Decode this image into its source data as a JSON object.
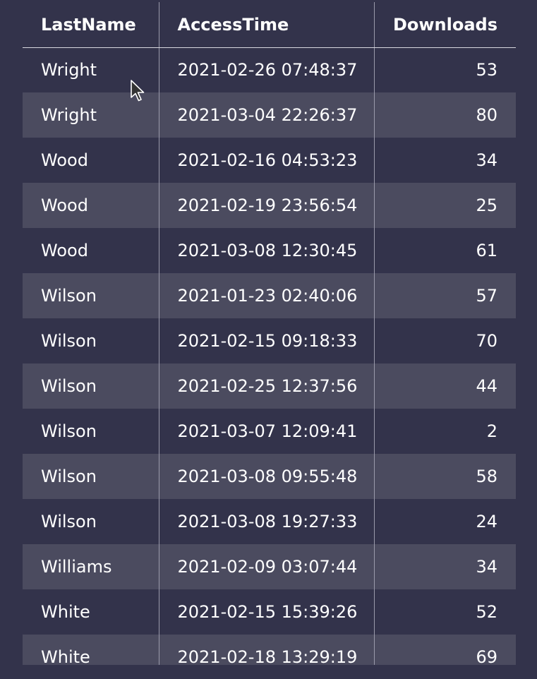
{
  "table": {
    "columns": [
      "LastName",
      "AccessTime",
      "Downloads"
    ],
    "rows": [
      [
        "Wright",
        "2021-02-26 07:48:37",
        "53"
      ],
      [
        "Wright",
        "2021-03-04 22:26:37",
        "80"
      ],
      [
        "Wood",
        "2021-02-16 04:53:23",
        "34"
      ],
      [
        "Wood",
        "2021-02-19 23:56:54",
        "25"
      ],
      [
        "Wood",
        "2021-03-08 12:30:45",
        "61"
      ],
      [
        "Wilson",
        "2021-01-23 02:40:06",
        "57"
      ],
      [
        "Wilson",
        "2021-02-15 09:18:33",
        "70"
      ],
      [
        "Wilson",
        "2021-02-25 12:37:56",
        "44"
      ],
      [
        "Wilson",
        "2021-03-07 12:09:41",
        "2"
      ],
      [
        "Wilson",
        "2021-03-08 09:55:48",
        "58"
      ],
      [
        "Wilson",
        "2021-03-08 19:27:33",
        "24"
      ],
      [
        "Williams",
        "2021-02-09 03:07:44",
        "34"
      ],
      [
        "White",
        "2021-02-15 15:39:26",
        "52"
      ],
      [
        "White",
        "2021-02-18 13:29:19",
        "69"
      ]
    ]
  },
  "colors": {
    "background": "#33334b",
    "row_alt": "#4b4b5f",
    "text": "#ffffff",
    "divider": "#9a9aab"
  },
  "icons": {
    "cursor": "mouse-pointer-icon"
  }
}
